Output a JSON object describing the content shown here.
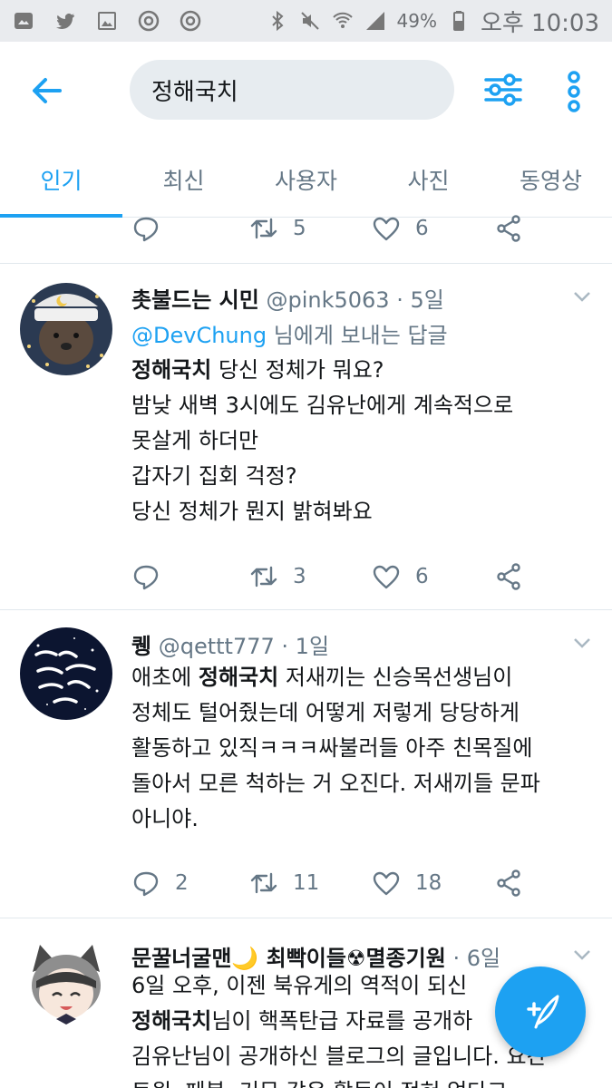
{
  "statusbar": {
    "battery": "49%",
    "time": "오후 10:03",
    "icons": [
      "gallery-icon",
      "twitter-icon",
      "image-icon",
      "chrome-icon",
      "chrome-icon",
      "bluetooth-icon",
      "mute-icon",
      "wifi-icon",
      "signal-icon",
      "battery-icon"
    ]
  },
  "search": {
    "query": "정해국치"
  },
  "tabs": [
    "인기",
    "최신",
    "사용자",
    "사진",
    "동영상"
  ],
  "top_actions": {
    "retweets": "5",
    "likes": "6"
  },
  "tweets": [
    {
      "name": "촛불드는 시민",
      "handle": "@pink5063",
      "time": "· 5일",
      "reply_prefix": "@DevChung",
      "reply_suffix": " 님에게 보내는 답글",
      "highlight": "정해국치",
      "lines": [
        " 당신 정체가 뭐요?",
        "밤낮 새벽 3시에도 김유난에게 계속적으로",
        "못살게 하더만",
        "갑자기 집회 걱정?",
        "당신 정체가 뭔지 밝혀봐요"
      ],
      "replies": "",
      "retweets": "3",
      "likes": "6"
    },
    {
      "name": "퀭",
      "handle": "@qettt777",
      "time": "· 1일",
      "prefix": "애초에 ",
      "highlight": "정해국치",
      "lines": [
        " 저새끼는 신승목선생님이",
        "정체도 털어줬는데 어떻게 저렇게 당당하게",
        "활동하고 있직ㅋㅋㅋ싸불러들 아주 친목질에",
        "돌아서 모른 척하는 거 오진다. 저새끼들 문파",
        "아니야."
      ],
      "replies": "2",
      "retweets": "11",
      "likes": "18"
    },
    {
      "name": "문꿀너굴맨🌙 최빡이들☢멸종기원",
      "handle": "",
      "time": "· 6일",
      "highlight": "정해국치",
      "lines": [
        "6일 오후, 이젠 북유게의 역적이 되신",
        "님이 핵폭탄급 자료를 공개하",
        "김유난님이 공개하신 블로그의 글입니다. 요간",
        "트윗, 페북, 커뮤 같은 활동이 전혀 없다고"
      ]
    }
  ],
  "colors": {
    "accent": "#1da1f2",
    "muted": "#657786",
    "text": "#14171a"
  }
}
